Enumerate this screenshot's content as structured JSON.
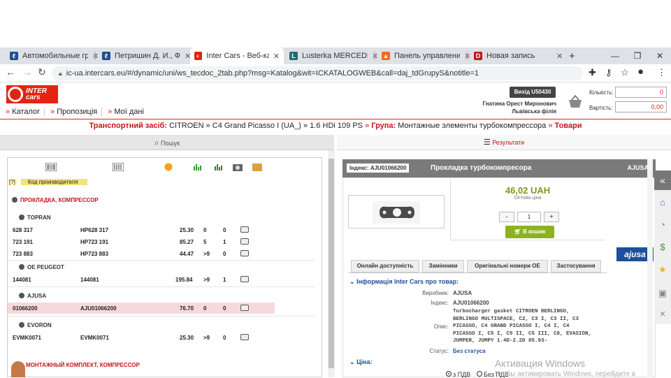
{
  "browser": {
    "tabs": [
      {
        "title": "Автомобильные грузо",
        "icon_color": "#1f4e8c",
        "active": false
      },
      {
        "title": "Петришин Д. И., ФЛ-П",
        "icon_color": "#1f4e8c",
        "active": false
      },
      {
        "title": "Inter Cars - Веб-катало",
        "icon_color": "#e42313",
        "active": true
      },
      {
        "title": "Lusterka MERCEDES AC",
        "icon_color": "#1f6e6a",
        "active": false
      },
      {
        "title": "Панель управления | S",
        "icon_color": "#f36c21",
        "active": false
      },
      {
        "title": "Новая запись",
        "icon_color": "#c4161c",
        "active": false
      }
    ],
    "new_tab": "+",
    "url": "ic-ua.intercars.eu/#/dynamic/uni/ws_tecdoc_2tab.php?msg=Katalog&wit=ICKATALOGWEB&call=daj_tdGrupyS&notitle=1"
  },
  "header": {
    "logo_line1": "INTER",
    "logo_line2": "cars",
    "nav": [
      "Каталог",
      "Пропозиція",
      "Мої дані"
    ],
    "exit_label": "Вихід  U50430",
    "user_name": "Гнатина Орест Миронович",
    "user_branch": "Львівська філія",
    "qty_label": "Кількість:",
    "qty_value": "0",
    "cost_label": "Вартість:",
    "cost_value": "0,00"
  },
  "vehicle": {
    "label": "Транспортний засіб:",
    "path": "CITROEN » C4 Grand Picasso I (UA_) » 1.6 HDi 109 PS",
    "group_label": "Група:",
    "group": "Монтажные элементы турбокомпрессора",
    "goods": "Товари"
  },
  "search_label": "Пошук",
  "results_label": "Результати",
  "list": {
    "hint_q": "[?]",
    "hint_mfr": "Код производителя",
    "sections": [
      {
        "title": "ПРОКЛАДКА, КОМПРЕССОР"
      },
      {
        "title": "МОНТАЖНЫЙ КОМПЛЕКТ, КОМПРЕССОР"
      }
    ],
    "brands": [
      "TOPRAN",
      "OE PEUGEOT",
      "AJUSA",
      "EVORON"
    ],
    "rows": [
      {
        "code": "628 317",
        "ref": "HP628 317",
        "price": "25.30",
        "a": "0",
        "b": "0"
      },
      {
        "code": "723 191",
        "ref": "HP723 191",
        "price": "85.27",
        "a": "5",
        "b": "1"
      },
      {
        "code": "723 883",
        "ref": "HP723 883",
        "price": "44.47",
        "a": ">9",
        "b": "0"
      },
      {
        "code": "144081",
        "ref": "144081",
        "price": "195.84",
        "a": ">9",
        "b": "1"
      },
      {
        "code": "01066200",
        "ref": "AJU01066200",
        "price": "76.70",
        "a": "0",
        "b": "0"
      },
      {
        "code": "EVMK0071",
        "ref": "EVMK0071",
        "price": "25.30",
        "a": ">9",
        "b": "0"
      }
    ]
  },
  "product": {
    "index_label": "Індекс: AJU01066200",
    "name": "Прокладка турбокомпресора",
    "brand": "AJUSA",
    "price": "46,02 UAH",
    "price_sub": "Оптова ціна",
    "minus": "-",
    "qty": "1",
    "plus": "+",
    "to_cart": "В кошик",
    "brand_logo": "ajusa",
    "tabs": [
      "Онлайн доступність",
      "Замінники",
      "Оригінальні номери ОЕ",
      "Застосування"
    ],
    "info_header": "Інформація Inter Cars про товар:",
    "maker_label": "Виробник:",
    "maker": "AJUSA",
    "index_lbl": "Індекс:",
    "index": "AJU01066200",
    "desc_label": "Опис:",
    "description": "Turbocharger gasket CITROEN BERLINGO, BERLINGO MULTISPACE, C2, C3 I, C3 II, C3 PICASSO, C4 GRAND PICASSO I, C4 I, C4 PICASSO I, C5 I, C5 II, C5 III, C8, EVASION, JUMPER, JUMPY 1.4D-2.2D 05.93-",
    "status_label": "Статус:",
    "status": "Без статуса",
    "price_header": "Ціна:",
    "radio_1": "з ПДВ",
    "radio_2": "Без ПДВ"
  },
  "watermark": {
    "line1": "Активация Windows",
    "line2": "Чтобы активировать Windows, перейдите в"
  }
}
